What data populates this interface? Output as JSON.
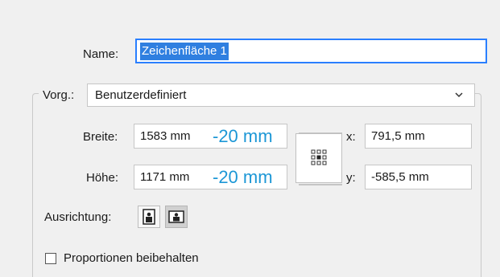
{
  "name": {
    "label": "Name:",
    "value": "Zeichenfläche 1"
  },
  "preset": {
    "label": "Vorg.:",
    "selected": "Benutzerdefiniert"
  },
  "width": {
    "label": "Breite:",
    "value": "1583 mm",
    "annotation": "-20 mm"
  },
  "height": {
    "label": "Höhe:",
    "value": "1171 mm",
    "annotation": "-20 mm"
  },
  "x": {
    "label": "x:",
    "value": "791,5 mm"
  },
  "y": {
    "label": "y:",
    "value": "-585,5 mm"
  },
  "orientation": {
    "label": "Ausrichtung:",
    "options": [
      "portrait",
      "landscape"
    ],
    "selected": "landscape"
  },
  "constrain": {
    "label": "Proportionen beibehalten",
    "checked": false
  },
  "colors": {
    "accent": "#2f7fe0",
    "annotation": "#1c97d6",
    "background": "#f0f0f0"
  }
}
